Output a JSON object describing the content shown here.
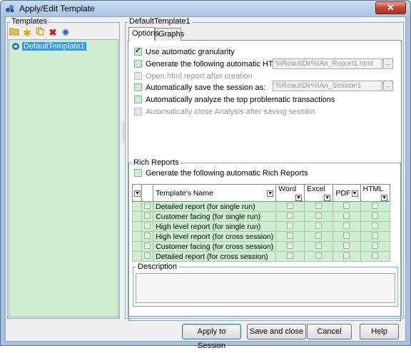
{
  "window": {
    "title": "Apply/Edit Template",
    "close_glyph": "✕"
  },
  "templates": {
    "group_label": "Templates",
    "toolbar": [
      "open-folder-icon",
      "new-star-icon",
      "copy-icon",
      "delete-icon",
      "settings-icon"
    ],
    "items": [
      "DefaultTemplate1"
    ]
  },
  "editor": {
    "group_label": "DefaultTemplate1",
    "tabs": [
      "Options",
      "Graphs"
    ],
    "options": {
      "auto_granularity": {
        "label": "Use automatic granularity",
        "checked": true
      },
      "gen_html": {
        "label": "Generate the following automatic HTML report",
        "path": "%ResultDir%\\An_Report1.html"
      },
      "open_html": {
        "label": "Open html report after creation",
        "disabled": true
      },
      "auto_save": {
        "label": "Automatically save the session as:",
        "path": "%ResultDir%\\An_Session1"
      },
      "auto_analyze": {
        "label": "Automatically analyze the top problematic transactions"
      },
      "auto_close": {
        "label": "Automatically close Analysis after saving session",
        "disabled": true
      }
    },
    "rich_reports": {
      "group_label": "Rich Reports",
      "generate_label": "Generate the following automatic Rich Reports",
      "columns": [
        "Template's Name",
        "Word",
        "Excel",
        "PDF",
        "HTML"
      ],
      "rows": [
        "Detailed report (for single run)",
        "Customer facing (for single run)",
        "High level report (for single run)",
        "High level report (for cross session)",
        "Customer facing (for cross session)",
        "Detailed report (for cross session)"
      ]
    },
    "description": {
      "group_label": "Description",
      "value": ""
    }
  },
  "buttons": {
    "apply": "Apply to Session",
    "save_close": "Save and close",
    "cancel": "Cancel",
    "help": "Help"
  },
  "colors": {
    "accent_green": "#ceeecf",
    "selection_blue": "#3399ff",
    "frame_blue": "#7aaed6"
  }
}
